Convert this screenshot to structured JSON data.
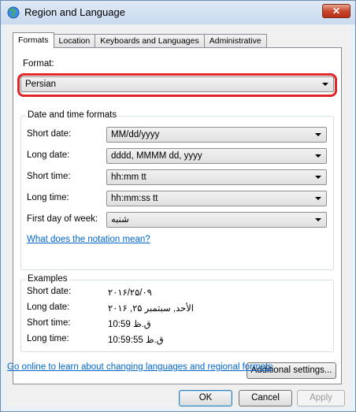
{
  "window": {
    "title": "Region and Language",
    "close_symbol": "✕"
  },
  "tabs": [
    "Formats",
    "Location",
    "Keyboards and Languages",
    "Administrative"
  ],
  "format": {
    "label": "Format:",
    "value": "Persian"
  },
  "date_time": {
    "group_title": "Date and time formats",
    "rows": [
      {
        "label": "Short date:",
        "value": "MM/dd/yyyy"
      },
      {
        "label": "Long date:",
        "value": "dddd, MMMM dd, yyyy"
      },
      {
        "label": "Short time:",
        "value": "hh:mm tt"
      },
      {
        "label": "Long time:",
        "value": "hh:mm:ss tt"
      },
      {
        "label": "First day of week:",
        "value": "شنبه"
      }
    ],
    "notation_link": "What does the notation mean?"
  },
  "examples": {
    "group_title": "Examples",
    "rows": [
      {
        "label": "Short date:",
        "value": "۲۰۱۶/۲۵/۰۹"
      },
      {
        "label": "Long date:",
        "value": "الأحد, سبتمبر ۲۵, ۲۰۱۶"
      },
      {
        "label": "Short time:",
        "value": "ق.ظ 10:59"
      },
      {
        "label": "Long time:",
        "value": "ق.ظ 10:59:55"
      }
    ]
  },
  "additional_settings": "Additional settings...",
  "online_link": "Go online to learn about changing languages and regional formats",
  "buttons": {
    "ok": "OK",
    "cancel": "Cancel",
    "apply": "Apply"
  }
}
